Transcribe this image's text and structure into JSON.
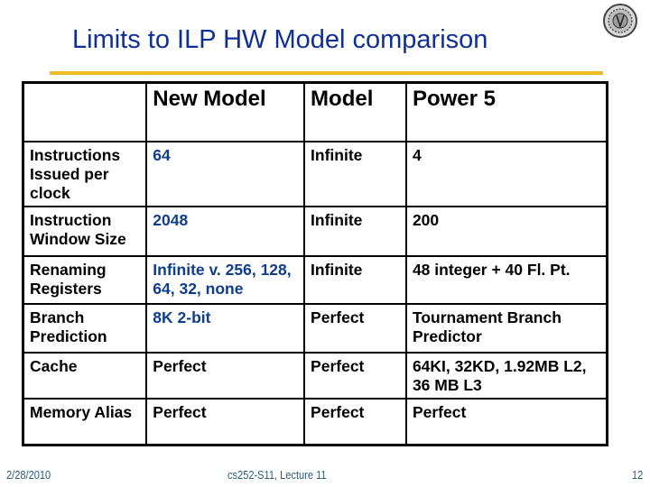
{
  "slide": {
    "title": "Limits to ILP HW Model comparison",
    "logo_icon": "university-seal-icon",
    "colors": {
      "title": "#0e2f96",
      "rule": "#efbb24",
      "highlight_column": "#0e3d8e",
      "footer": "#2a5d7c"
    }
  },
  "table": {
    "headers": [
      "",
      "New Model",
      "Model",
      "Power 5"
    ],
    "rows": [
      {
        "label": "Instructions Issued per clock",
        "new_model": "64",
        "model": "Infinite",
        "power5": "4"
      },
      {
        "label": "Instruction Window Size",
        "new_model": "2048",
        "model": "Infinite",
        "power5": "200"
      },
      {
        "label": "Renaming Registers",
        "new_model": "Infinite v. 256, 128, 64, 32, none",
        "model": "Infinite",
        "power5": "48 integer + 40 Fl. Pt."
      },
      {
        "label": "Branch Prediction",
        "new_model": "8K 2-bit",
        "model": "Perfect",
        "power5": "Tournament Branch Predictor"
      },
      {
        "label": "Cache",
        "new_model": "Perfect",
        "model": "Perfect",
        "power5": "64KI, 32KD, 1.92MB L2, 36 MB L3"
      },
      {
        "label": "Memory Alias",
        "new_model": "Perfect",
        "model": "Perfect",
        "power5": "Perfect"
      }
    ]
  },
  "footer": {
    "date": "2/28/2010",
    "course": "cs252-S11, Lecture 11",
    "page": "12"
  }
}
